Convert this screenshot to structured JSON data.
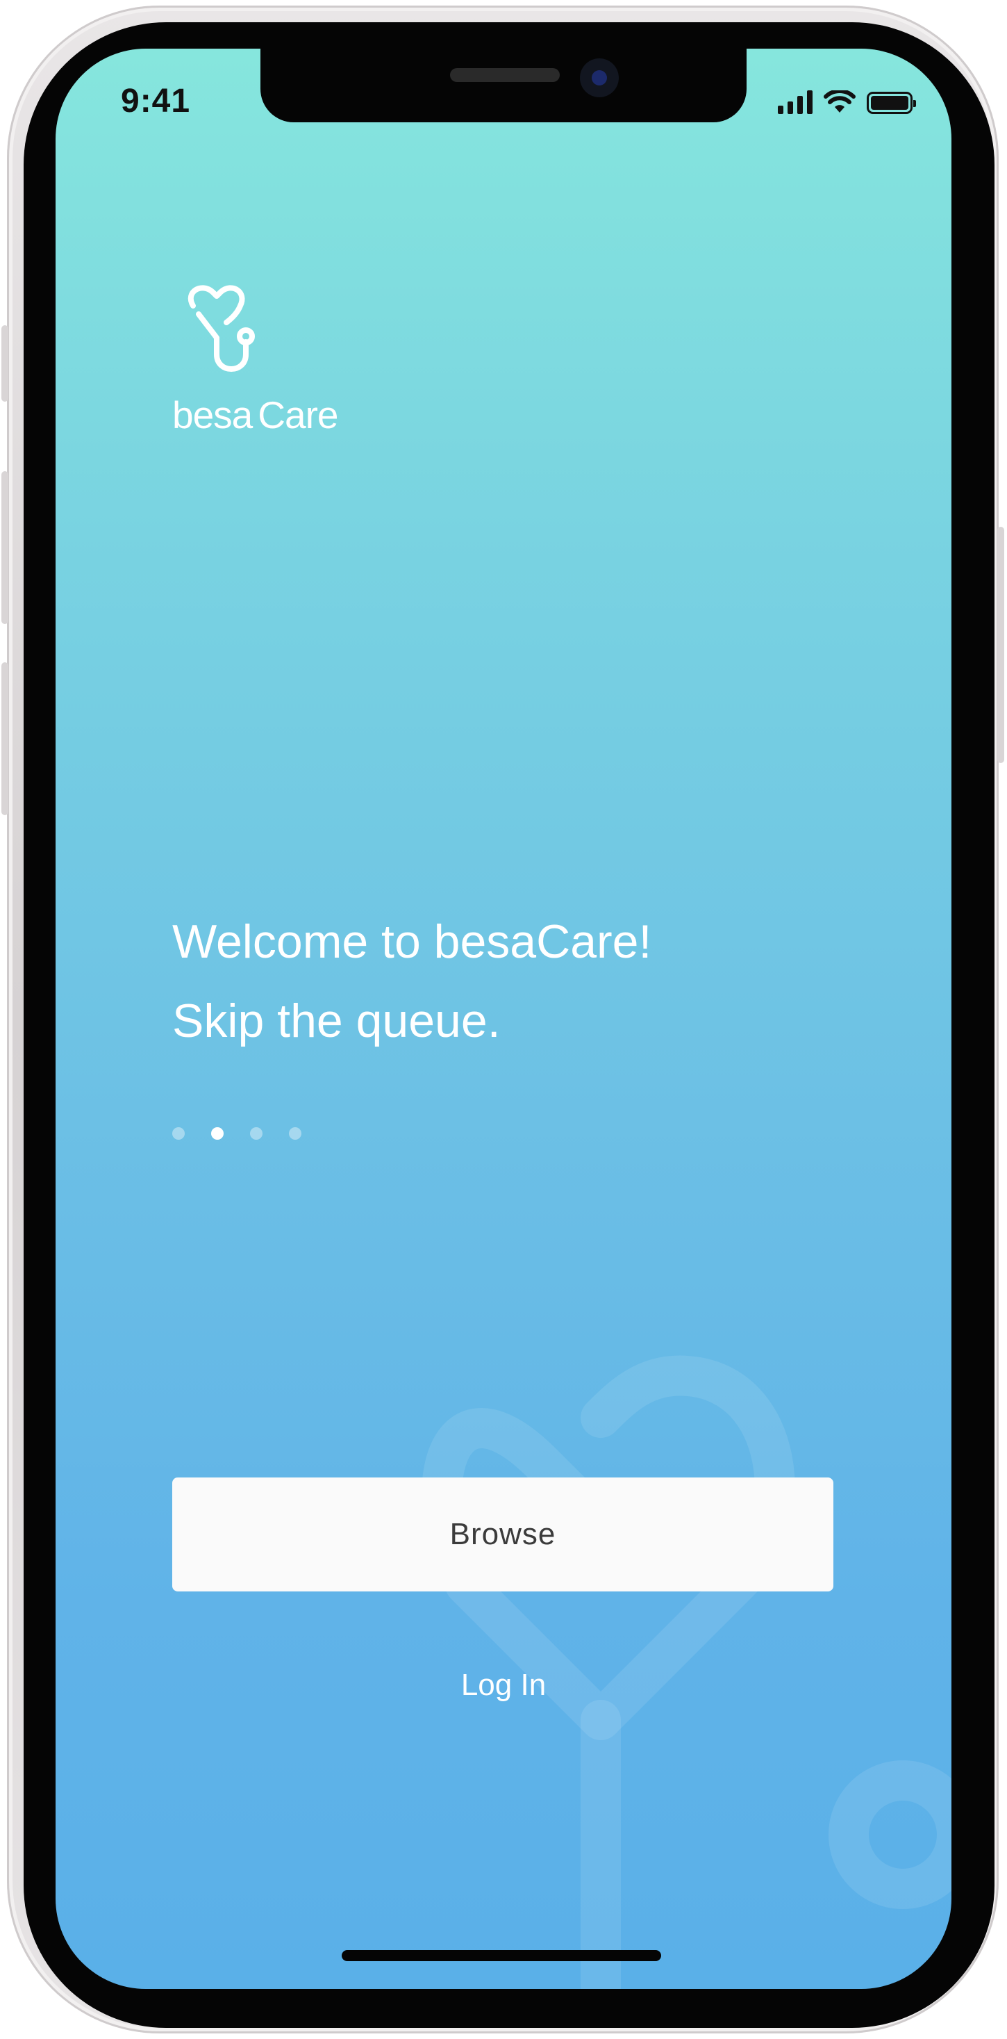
{
  "status_bar": {
    "time": "9:41",
    "icons": [
      "cellular-signal-icon",
      "wifi-icon",
      "battery-icon"
    ],
    "battery_level": 1.0
  },
  "brand": {
    "logo_icon": "heart-stethoscope-icon",
    "name_part1": "besa",
    "name_part2": "Care"
  },
  "onboarding": {
    "line1": "Welcome to besaCare!",
    "line2": "Skip the queue.",
    "page_count": 4,
    "active_page": 2
  },
  "actions": {
    "browse_label": "Browse",
    "login_label": "Log In"
  },
  "colors": {
    "gradient_top": "#86e6dd",
    "gradient_bottom": "#5ab0e8",
    "primary_button_bg": "#fafafa",
    "primary_button_text": "#3b3b3b",
    "text_on_bg": "#ffffff"
  }
}
